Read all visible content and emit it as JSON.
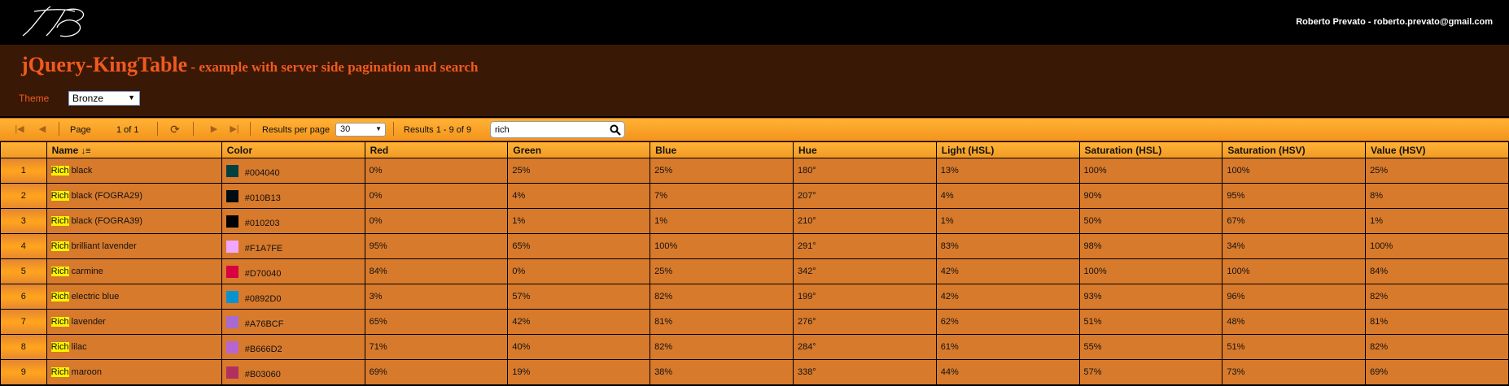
{
  "header": {
    "user_text": "Roberto Prevato - roberto.prevato@gmail.com",
    "title_main": "jQuery-KingTable",
    "title_sub": " - example with server side pagination and search"
  },
  "theme": {
    "label": "Theme",
    "selected": "Bronze"
  },
  "pager": {
    "page_label": "Page",
    "page_value": "1 of 1",
    "rpp_label": "Results per page",
    "rpp_value": "30",
    "results_label": "Results 1 - 9 of 9",
    "search_value": "rich"
  },
  "table": {
    "columns": [
      "",
      "Name",
      "Color",
      "Red",
      "Green",
      "Blue",
      "Hue",
      "Light (HSL)",
      "Saturation (HSL)",
      "Saturation (HSV)",
      "Value (HSV)"
    ],
    "rows": [
      {
        "num": "1",
        "hl": "Rich",
        "rest": " black",
        "hex": "#004040",
        "color": "#004040",
        "red": "0%",
        "green": "25%",
        "blue": "25%",
        "hue": "180°",
        "light": "13%",
        "sat_hsl": "100%",
        "sat_hsv": "100%",
        "value": "25%"
      },
      {
        "num": "2",
        "hl": "Rich",
        "rest": " black (FOGRA29)",
        "hex": "#010B13",
        "color": "#010B13",
        "red": "0%",
        "green": "4%",
        "blue": "7%",
        "hue": "207°",
        "light": "4%",
        "sat_hsl": "90%",
        "sat_hsv": "95%",
        "value": "8%"
      },
      {
        "num": "3",
        "hl": "Rich",
        "rest": " black (FOGRA39)",
        "hex": "#010203",
        "color": "#010203",
        "red": "0%",
        "green": "1%",
        "blue": "1%",
        "hue": "210°",
        "light": "1%",
        "sat_hsl": "50%",
        "sat_hsv": "67%",
        "value": "1%"
      },
      {
        "num": "4",
        "hl": "Rich",
        "rest": " brilliant lavender",
        "hex": "#F1A7FE",
        "color": "#F1A7FE",
        "red": "95%",
        "green": "65%",
        "blue": "100%",
        "hue": "291°",
        "light": "83%",
        "sat_hsl": "98%",
        "sat_hsv": "34%",
        "value": "100%"
      },
      {
        "num": "5",
        "hl": "Rich",
        "rest": " carmine",
        "hex": "#D70040",
        "color": "#D70040",
        "red": "84%",
        "green": "0%",
        "blue": "25%",
        "hue": "342°",
        "light": "42%",
        "sat_hsl": "100%",
        "sat_hsv": "100%",
        "value": "84%"
      },
      {
        "num": "6",
        "hl": "Rich",
        "rest": " electric blue",
        "hex": "#0892D0",
        "color": "#0892D0",
        "red": "3%",
        "green": "57%",
        "blue": "82%",
        "hue": "199°",
        "light": "42%",
        "sat_hsl": "93%",
        "sat_hsv": "96%",
        "value": "82%"
      },
      {
        "num": "7",
        "hl": "Rich",
        "rest": " lavender",
        "hex": "#A76BCF",
        "color": "#A76BCF",
        "red": "65%",
        "green": "42%",
        "blue": "81%",
        "hue": "276°",
        "light": "62%",
        "sat_hsl": "51%",
        "sat_hsv": "48%",
        "value": "81%"
      },
      {
        "num": "8",
        "hl": "Rich",
        "rest": " lilac",
        "hex": "#B666D2",
        "color": "#B666D2",
        "red": "71%",
        "green": "40%",
        "blue": "82%",
        "hue": "284°",
        "light": "61%",
        "sat_hsl": "55%",
        "sat_hsv": "51%",
        "value": "82%"
      },
      {
        "num": "9",
        "hl": "Rich",
        "rest": " maroon",
        "hex": "#B03060",
        "color": "#B03060",
        "red": "69%",
        "green": "19%",
        "blue": "38%",
        "hue": "338°",
        "light": "44%",
        "sat_hsl": "57%",
        "sat_hsv": "73%",
        "value": "69%"
      }
    ]
  }
}
